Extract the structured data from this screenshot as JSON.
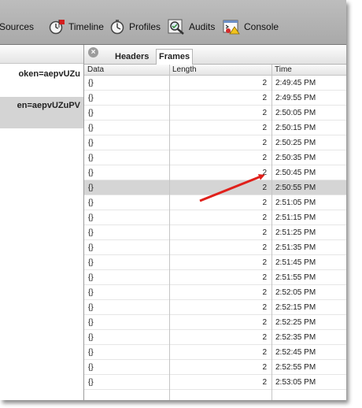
{
  "toolbar": {
    "items": [
      {
        "label": "Sources",
        "icon": "sources-icon"
      },
      {
        "label": "Timeline",
        "icon": "timeline-icon"
      },
      {
        "label": "Profiles",
        "icon": "profiles-icon"
      },
      {
        "label": "Audits",
        "icon": "audits-icon"
      },
      {
        "label": "Console",
        "icon": "console-icon"
      }
    ]
  },
  "requests": [
    {
      "label": "oken=aepvUZu"
    },
    {
      "label": "en=aepvUZuPV"
    }
  ],
  "tabs": {
    "headers": "Headers",
    "frames": "Frames"
  },
  "table": {
    "columns": [
      "Data",
      "Length",
      "Time"
    ],
    "selected_index": 7,
    "rows": [
      {
        "data": "{}",
        "length": "2",
        "time": "2:49:45 PM"
      },
      {
        "data": "{}",
        "length": "2",
        "time": "2:49:55 PM"
      },
      {
        "data": "{}",
        "length": "2",
        "time": "2:50:05 PM"
      },
      {
        "data": "{}",
        "length": "2",
        "time": "2:50:15 PM"
      },
      {
        "data": "{}",
        "length": "2",
        "time": "2:50:25 PM"
      },
      {
        "data": "{}",
        "length": "2",
        "time": "2:50:35 PM"
      },
      {
        "data": "{}",
        "length": "2",
        "time": "2:50:45 PM"
      },
      {
        "data": "{}",
        "length": "2",
        "time": "2:50:55 PM"
      },
      {
        "data": "{}",
        "length": "2",
        "time": "2:51:05 PM"
      },
      {
        "data": "{}",
        "length": "2",
        "time": "2:51:15 PM"
      },
      {
        "data": "{}",
        "length": "2",
        "time": "2:51:25 PM"
      },
      {
        "data": "{}",
        "length": "2",
        "time": "2:51:35 PM"
      },
      {
        "data": "{}",
        "length": "2",
        "time": "2:51:45 PM"
      },
      {
        "data": "{}",
        "length": "2",
        "time": "2:51:55 PM"
      },
      {
        "data": "{}",
        "length": "2",
        "time": "2:52:05 PM"
      },
      {
        "data": "{}",
        "length": "2",
        "time": "2:52:15 PM"
      },
      {
        "data": "{}",
        "length": "2",
        "time": "2:52:25 PM"
      },
      {
        "data": "{}",
        "length": "2",
        "time": "2:52:35 PM"
      },
      {
        "data": "{}",
        "length": "2",
        "time": "2:52:45 PM"
      },
      {
        "data": "{}",
        "length": "2",
        "time": "2:52:55 PM"
      },
      {
        "data": "{}",
        "length": "2",
        "time": "2:53:05 PM"
      }
    ]
  },
  "colors": {
    "toolbar": "#b3b3b3",
    "selected_row": "#d5d5d5",
    "annotation_arrow": "#e0201b"
  }
}
